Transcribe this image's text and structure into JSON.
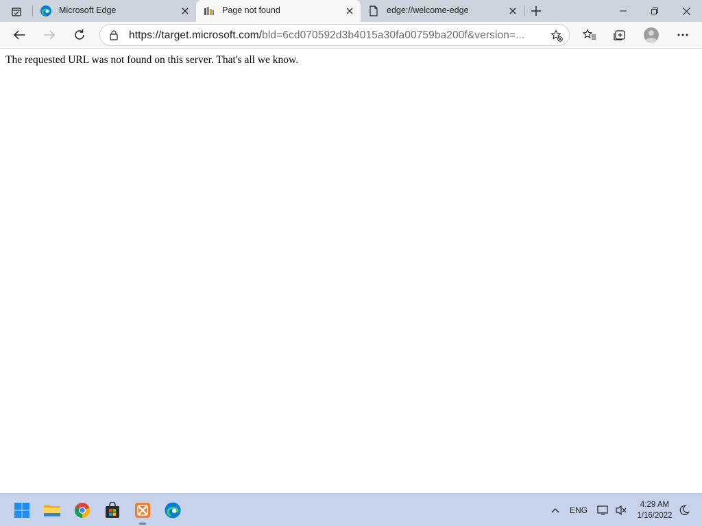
{
  "browser": {
    "tabs": [
      {
        "title": "Microsoft Edge",
        "favicon": "edge-logo-icon",
        "active": false
      },
      {
        "title": "Page not found",
        "favicon": "page-favicon-icon",
        "active": true
      },
      {
        "title": "edge://welcome-edge",
        "favicon": "document-icon",
        "active": false
      }
    ],
    "address": {
      "url_host": "https://target.microsoft.com/",
      "url_rest": "bld=6cd070592d3b4015a30fa00759ba200f&version=..."
    }
  },
  "page": {
    "message": "The requested URL was not found on this server. That's all we know."
  },
  "taskbar": {
    "apps": [
      "start-icon",
      "file-explorer-icon",
      "chrome-icon",
      "store-icon",
      "xampp-icon",
      "edge-icon"
    ],
    "language": "ENG",
    "time": "4:29 AM",
    "date": "1/16/2022"
  },
  "colors": {
    "tabstrip": "#ccd3dc",
    "toolbar": "#f7f7f7",
    "taskbar": "#c6d3ea",
    "accent": "#0078d4"
  }
}
